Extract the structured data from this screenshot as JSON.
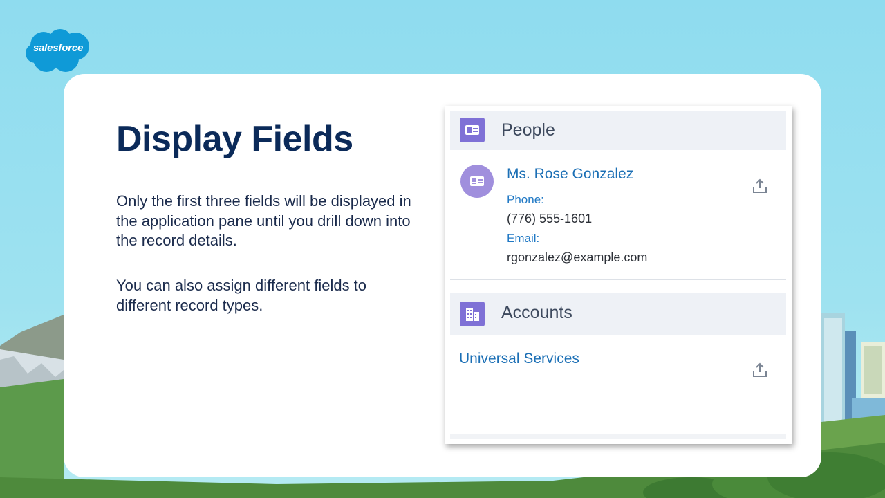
{
  "brand": {
    "logo_text": "salesforce"
  },
  "slide": {
    "title": "Display Fields",
    "paragraphs": [
      "Only the first three fields will be displayed in the application pane until you drill down into the record details.",
      "You can also assign different fields to different record types."
    ]
  },
  "panel": {
    "people": {
      "header": "People",
      "header_icon": "contact-card-icon",
      "record": {
        "avatar_icon": "contact-card-icon",
        "name": "Ms. Rose Gonzalez",
        "phone_label": "Phone:",
        "phone": "(776) 555-1601",
        "email_label": "Email:",
        "email": "rgonzalez@example.com",
        "action_icon": "share-upload-icon"
      }
    },
    "accounts": {
      "header": "Accounts",
      "header_icon": "building-icon",
      "record": {
        "name": "Universal Services",
        "action_icon": "share-upload-icon"
      }
    }
  },
  "colors": {
    "title": "#0b2a59",
    "link": "#1b6fb5",
    "icon_purple": "#7f71d6",
    "sky": "#9ee2f0"
  }
}
